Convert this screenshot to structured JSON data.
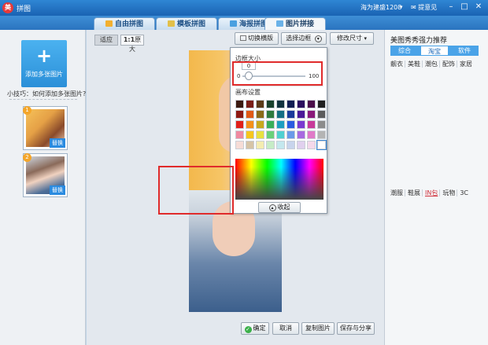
{
  "titlebar": {
    "app_title": "拼图",
    "user": "海为建盛1208",
    "feedback": "提意见"
  },
  "tabs": [
    {
      "label": "自由拼图",
      "icon": "free-collage-icon"
    },
    {
      "label": "模板拼图",
      "icon": "template-collage-icon"
    },
    {
      "label": "海报拼图",
      "icon": "poster-collage-icon"
    },
    {
      "label": "图片拼接",
      "icon": "image-splice-icon",
      "active": true
    }
  ],
  "left": {
    "add_label": "添加多张图片",
    "tip": "小技巧：如何添加多张图片?",
    "thumbs": [
      {
        "num": "1",
        "replace": "替换"
      },
      {
        "num": "2",
        "replace": "替换"
      }
    ]
  },
  "toolbar": {
    "fit": "适应",
    "orig_prefix": "1:1",
    "orig": "原大",
    "switch_layout": "切换横版",
    "select_border": "选择边框",
    "resize": "修改尺寸"
  },
  "popup": {
    "border_size_title": "边框大小",
    "value": "0",
    "min": "0",
    "max": "100",
    "bg_title": "画布设置",
    "collapse": "收起",
    "swatches": [
      "#3a1a10",
      "#7a1e16",
      "#5a3a18",
      "#18402c",
      "#10323e",
      "#101e52",
      "#2a0e5e",
      "#4a0e4a",
      "#202020",
      "#8e1a12",
      "#e05a16",
      "#8a6a18",
      "#2e7a3e",
      "#146e84",
      "#1a3a9a",
      "#4a1a98",
      "#8a1a7a",
      "#5c5c5c",
      "#e0201a",
      "#f4901a",
      "#c8a81e",
      "#3aae5a",
      "#1e9ec0",
      "#2a5ce0",
      "#7a3ad0",
      "#c83a9a",
      "#8c8c8c",
      "#f08aa0",
      "#f6c61e",
      "#e8e040",
      "#6ad07a",
      "#50d0d0",
      "#6a9ae8",
      "#a86ae0",
      "#e07ac8",
      "#b4b4b4",
      "#f6dcd6",
      "#d6c4a6",
      "#f4ecb0",
      "#c6ecc6",
      "#c4e8ee",
      "#c8d4ec",
      "#e0d0ee",
      "#f4d8ea",
      "#ffffff"
    ]
  },
  "actions": {
    "ok": "确定",
    "cancel": "取消",
    "copy": "复制图片",
    "save_share": "保存与分享"
  },
  "right": {
    "title": "美图秀秀强力推荐",
    "tabs": [
      "综合",
      "淘宝",
      "软件"
    ],
    "cats_top": [
      "靓衣",
      "美鞋",
      "潮包",
      "配饰",
      "家居"
    ],
    "cats_bottom": [
      "潮服",
      "鞋展",
      "IN包",
      "玩物",
      "3C"
    ]
  }
}
